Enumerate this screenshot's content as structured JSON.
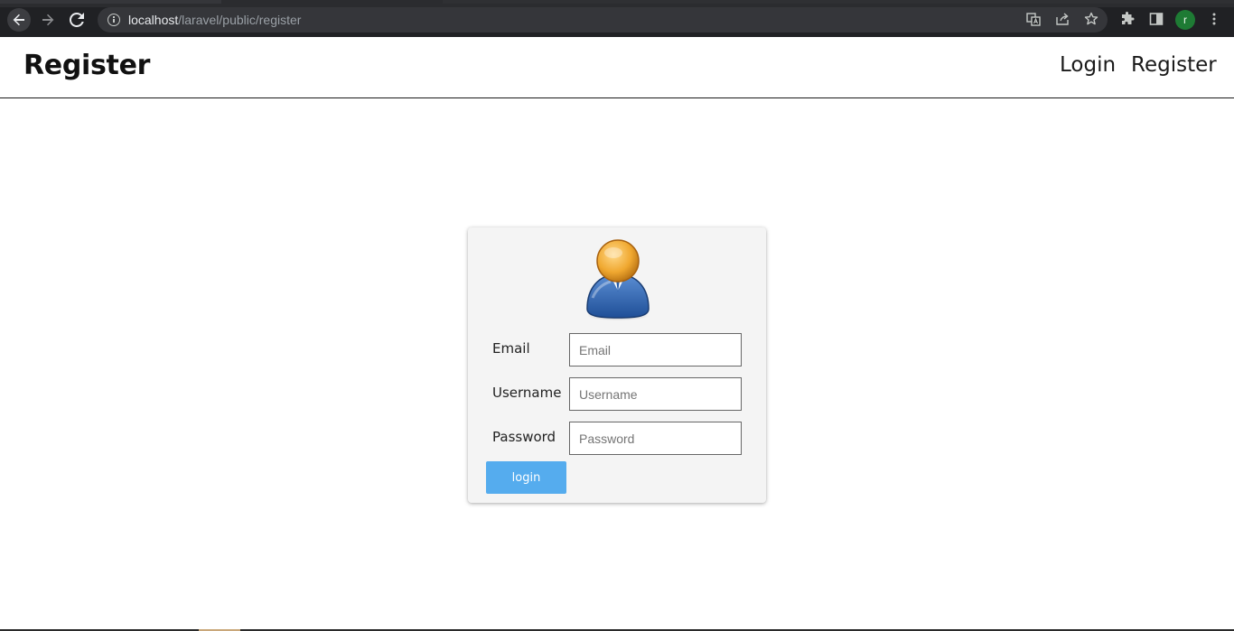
{
  "browser": {
    "url_host": "localhost",
    "url_path": "/laravel/public/register",
    "profile_initial": "r"
  },
  "header": {
    "title": "Register",
    "nav": {
      "login": "Login",
      "register": "Register"
    }
  },
  "form": {
    "email_label": "Email",
    "email_placeholder": "Email",
    "username_label": "Username",
    "username_placeholder": "Username",
    "password_label": "Password",
    "password_placeholder": "Password",
    "submit_label": "login"
  },
  "colors": {
    "button": "#55acee",
    "card_bg": "#f4f4f4",
    "chrome_bg": "#202124"
  },
  "icons": [
    "back-arrow-icon",
    "forward-arrow-icon",
    "reload-icon",
    "info-icon",
    "translate-icon",
    "share-icon",
    "bookmark-star-icon",
    "extensions-icon",
    "side-panel-icon",
    "menu-dots-icon",
    "user-avatar-icon"
  ]
}
